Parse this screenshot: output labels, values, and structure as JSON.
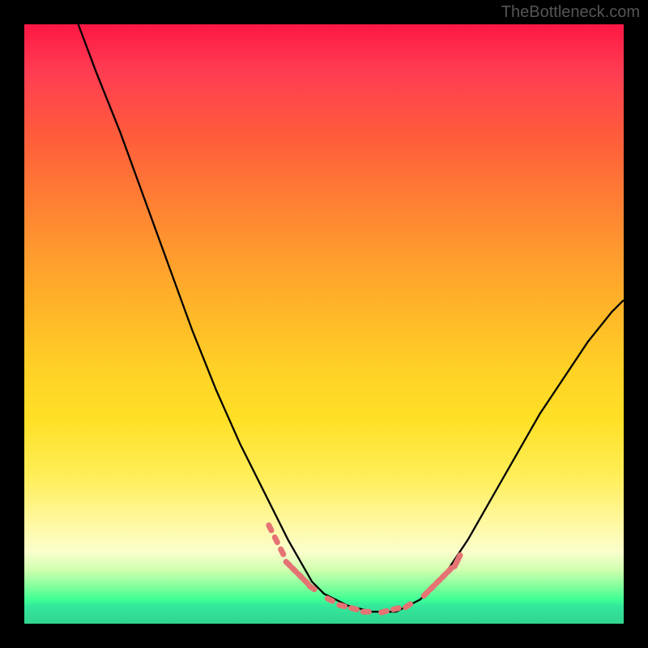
{
  "watermark": "TheBottleneck.com",
  "chart_data": {
    "type": "line",
    "title": "",
    "xlabel": "",
    "ylabel": "",
    "xlim": [
      0,
      100
    ],
    "ylim": [
      0,
      100
    ],
    "series": [
      {
        "name": "curve",
        "x": [
          9,
          12,
          16,
          20,
          24,
          28,
          32,
          36,
          40,
          44,
          48,
          50,
          52,
          54,
          56,
          58,
          60,
          62,
          64,
          66,
          70,
          74,
          78,
          82,
          86,
          90,
          94,
          98,
          100
        ],
        "y": [
          100,
          92,
          82,
          71,
          60,
          49,
          39,
          30,
          22,
          14,
          7,
          5,
          4,
          3,
          2.5,
          2,
          2,
          2,
          3,
          4,
          8,
          14,
          21,
          28,
          35,
          41,
          47,
          52,
          54
        ]
      }
    ],
    "markers": {
      "name": "gpu-points",
      "x": [
        41,
        42,
        43,
        44,
        45,
        46,
        47,
        48,
        51,
        53,
        55,
        57,
        60,
        62,
        64,
        67,
        68,
        69,
        70,
        71,
        72,
        72.5
      ],
      "y": [
        16,
        14,
        12,
        10,
        9,
        8,
        7,
        6,
        4,
        3,
        2.5,
        2,
        2,
        2.5,
        3,
        5,
        6,
        7,
        8,
        9,
        10,
        11
      ],
      "color": "#e57373",
      "size": 6
    },
    "colors": {
      "gradient_top": "#ff1744",
      "gradient_mid": "#ffe026",
      "gradient_bottom": "#31d490",
      "curve": "#000000",
      "marker": "#e57373",
      "frame": "#000000"
    }
  }
}
